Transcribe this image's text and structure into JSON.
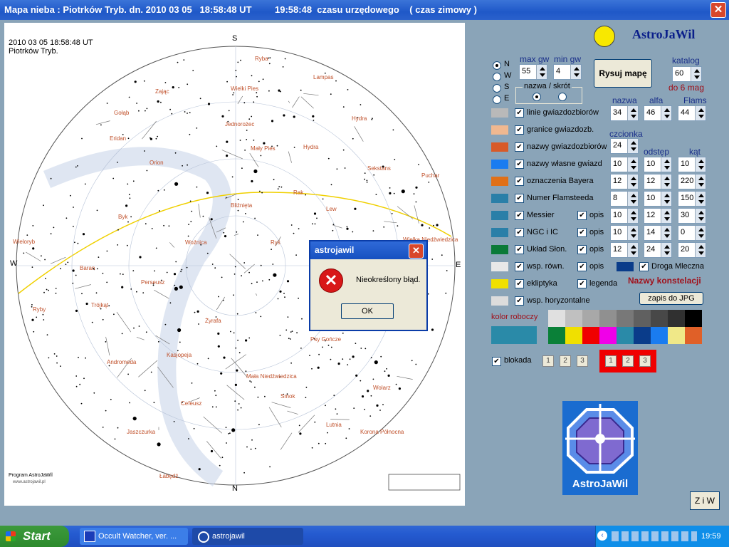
{
  "window": {
    "title": "Mapa nieba : Piotrków Tryb. dn. 2010 03 05   18:58:48 UT         19:58:48  czasu urzędowego    ( czas zimowy )",
    "close_glyph": "✕"
  },
  "map": {
    "datetime": "2010 03 05   18:58:48 UT",
    "place": "Piotrków Tryb.",
    "program": "Program AstroJaWil",
    "url": "www.astrojawil.pl",
    "directions": {
      "s": "S",
      "n": "N",
      "w": "W",
      "e": "E"
    },
    "constellations": [
      "Ryba",
      "Lampas",
      "Zając",
      "Wielki Pies",
      "Gołąb",
      "Jednorożec",
      "Eridan",
      "Orion",
      "Hydra",
      "Mały Pies",
      "Hydra",
      "Sekstans",
      "Puchar",
      "Rak",
      "Byk",
      "Bliźnięta",
      "Lew",
      "Wieloryb",
      "Woźnica",
      "Ryś",
      "Baran",
      "Perseusz",
      "Trójkąt",
      "Ryby",
      "Żyrafa",
      "Kasjopeja",
      "Andromeda",
      "Mała Niedźwiedzica",
      "Smok",
      "Jaszczurka",
      "Cefeusz",
      "Wolarz",
      "Lutnia",
      "Łabędź",
      "Korona Północna",
      "Psy Gończe",
      "Warkocz Bereniki",
      "Wielka Niedźwiedzica"
    ]
  },
  "controls": {
    "radio_dirs": [
      "N",
      "W",
      "S",
      "E"
    ],
    "max_gw_label": "max gw",
    "max_gw": "55",
    "min_gw_label": "min gw",
    "min_gw": "4",
    "draw_button": "Rysuj mapę",
    "katalog_label": "katalog",
    "katalog": "60",
    "do_mag": "do 6 mag",
    "nazwa_skrot": "nazwa / skrót",
    "col_nazwa": "nazwa",
    "col_alfa": "alfa",
    "col_flams": "Flams",
    "nazwa_val": "34",
    "alfa_val": "46",
    "flams_val": "44",
    "czcionka_label": "czcionka",
    "czcionka": "24",
    "odstep_label": "odstęp",
    "kat_label": "kąt",
    "rows": [
      {
        "label": "linie gwiazdozbiorów",
        "color": "#b9b9b9"
      },
      {
        "label": "granice gwiazdozb.",
        "color": "#f0b890"
      },
      {
        "label": "nazwy gwiazdozbiorów",
        "color": "#d85a28"
      },
      {
        "label": "nazwy własne gwiazd",
        "color": "#1a7cf0",
        "v1": "10",
        "v2": "10",
        "v3": "10"
      },
      {
        "label": "oznaczenia Bayera",
        "color": "#e07018",
        "v1": "12",
        "v2": "12",
        "v3": "220"
      },
      {
        "label": "Numer Flamsteeda",
        "color": "#2a7fa8",
        "v1": "8",
        "v2": "10",
        "v3": "150"
      },
      {
        "label": "Messier",
        "color": "#2a7fa8",
        "v1": "10",
        "v2": "12",
        "v3": "30"
      },
      {
        "label": "NGC  i  IC",
        "color": "#2a7fa8",
        "v1": "10",
        "v2": "14",
        "v3": "0"
      },
      {
        "label": "Układ Słon.",
        "color": "#0a7a38",
        "v1": "12",
        "v2": "24",
        "v3": "20"
      },
      {
        "label": "wsp. równ.",
        "color": "#e8e8e8"
      },
      {
        "label": "ekliptyka",
        "color": "#f0e000"
      },
      {
        "label": "wsp. horyzontalne",
        "color": "#dcdcdc"
      }
    ],
    "opis": "opis",
    "droga_mleczna": "Droga Mleczna",
    "droga_color": "#0a3c8a",
    "nazwy_konstelacji": "Nazwy konstelacji",
    "legenda": "legenda",
    "save_jpg": "zapis do JPG",
    "kolor_roboczy": "kolor roboczy",
    "kolor_roboczy_color": "#2a8aa8",
    "palette_row1": [
      "#e0e0e0",
      "#c0c0c0",
      "#a8a8a8",
      "#909090",
      "#787878",
      "#606060",
      "#484848",
      "#303030",
      "#000000"
    ],
    "palette_row2": [
      "#0a8038",
      "#f0e000",
      "#f00000",
      "#f000e8",
      "#2a8aa8",
      "#0a3c8a",
      "#1a7cf0",
      "#f0e888",
      "#e06028"
    ],
    "blokada": "blokada",
    "slots_a": [
      "1",
      "2",
      "3"
    ],
    "slots_b": [
      "1",
      "2",
      "3"
    ],
    "logo_text": "AstroJaWil",
    "ziw": "Z i W",
    "brand": "AstroJaWil"
  },
  "dialog": {
    "title": "astrojawil",
    "message": "Nieokreślony błąd.",
    "ok": "OK"
  },
  "taskbar": {
    "start": "Start",
    "task1": "Occult Watcher, ver. ...",
    "task2": "astrojawil",
    "clock": "19:59"
  }
}
